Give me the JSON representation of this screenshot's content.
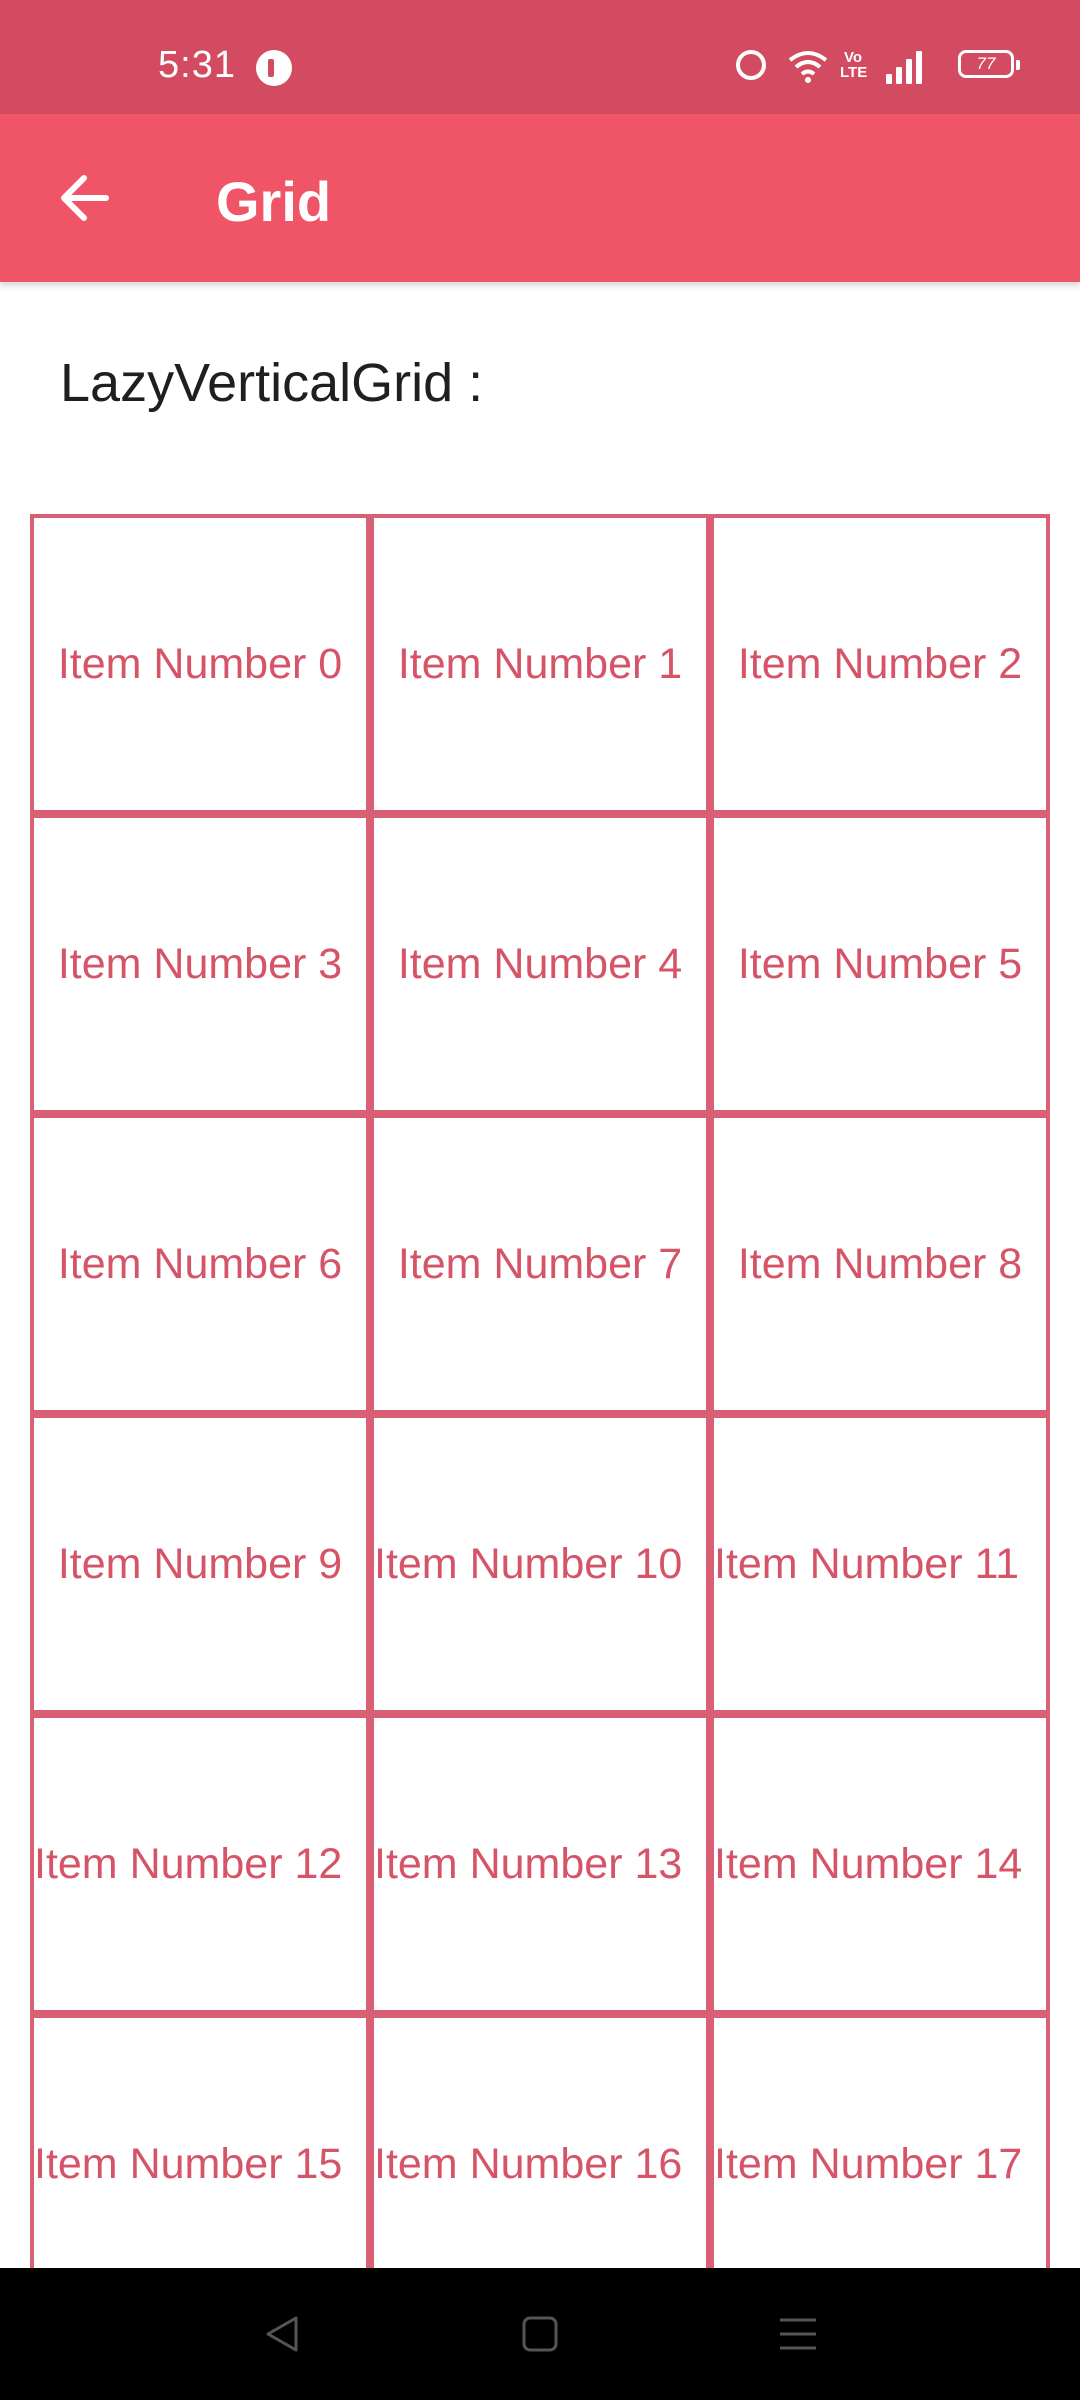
{
  "status_bar": {
    "time": "5:31",
    "battery": "77",
    "network_label": "Vo LTE"
  },
  "app_bar": {
    "title": "Grid"
  },
  "section": {
    "heading": "LazyVerticalGrid :"
  },
  "grid": {
    "items": [
      "Item Number 0",
      "Item Number 1",
      "Item Number 2",
      "Item Number 3",
      "Item Number 4",
      "Item Number 5",
      "Item Number 6",
      "Item Number 7",
      "Item Number 8",
      "Item Number 9",
      "Item Number 10",
      "Item Number 11",
      "Item Number 12",
      "Item Number 13",
      "Item Number 14",
      "Item Number 15",
      "Item Number 16",
      "Item Number 17"
    ]
  },
  "colors": {
    "status_bar": "#d24b60",
    "app_bar": "#f05567",
    "grid_border": "#d95f74",
    "grid_text": "#d65468"
  },
  "icons": {
    "back": "arrow-left-icon",
    "alarm": "alarm-icon",
    "wifi": "wifi-icon",
    "signal": "signal-icon",
    "battery": "battery-icon",
    "nav_back": "triangle-back-icon",
    "nav_home": "square-home-icon",
    "nav_menu": "menu-lines-icon"
  }
}
